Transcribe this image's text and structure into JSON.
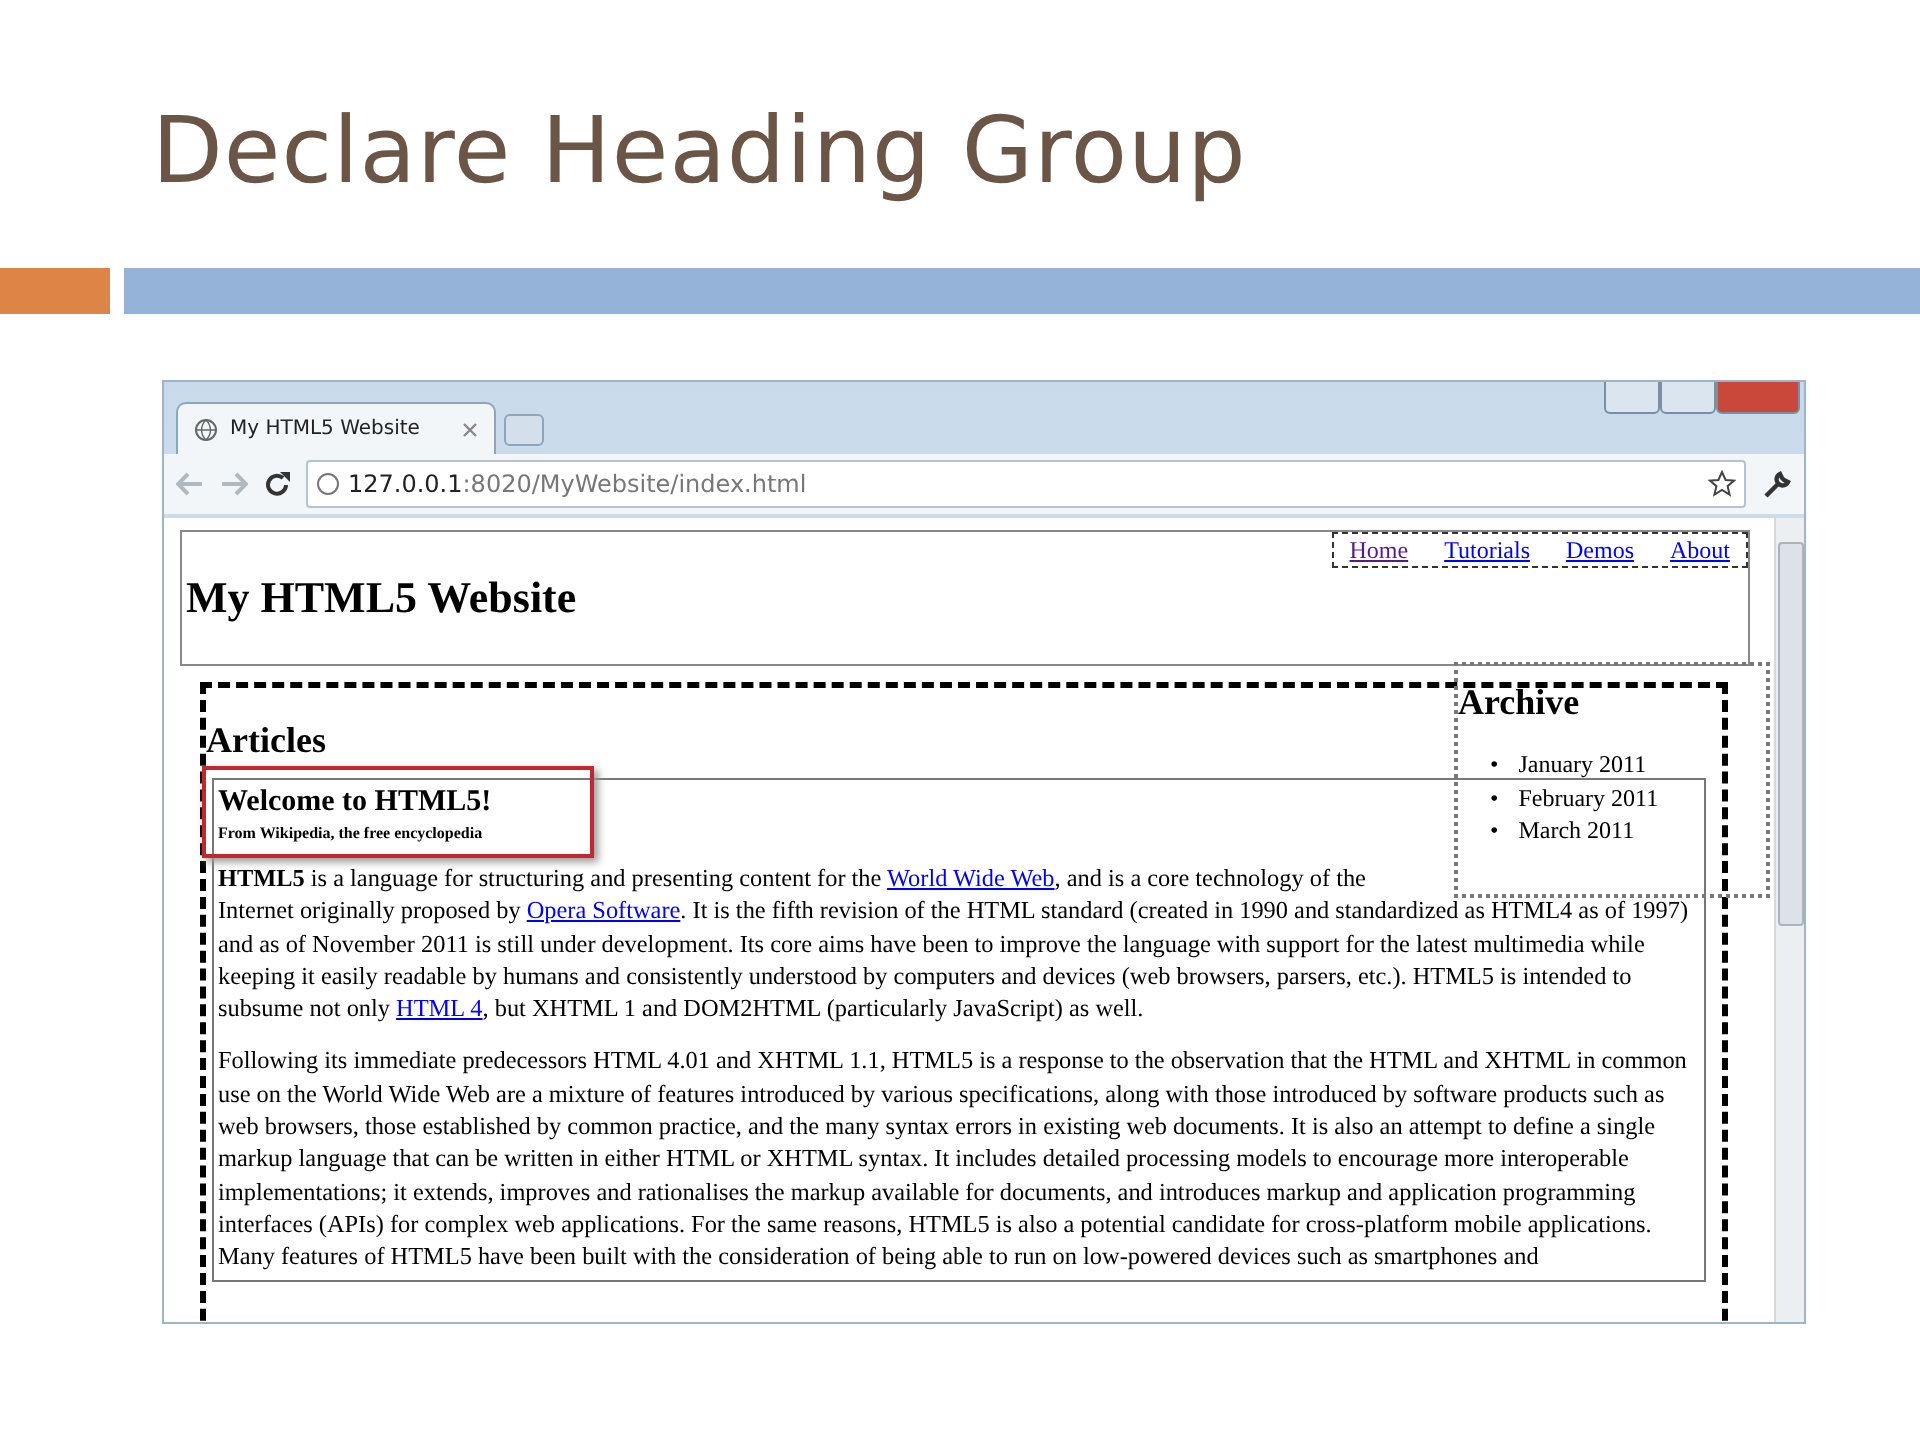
{
  "slide": {
    "title": "Declare Heading Group"
  },
  "browser": {
    "tab": {
      "title": "My HTML5 Website",
      "selected": true
    },
    "address": {
      "host": "127.0.0.1",
      "rest": ":8020/MyWebsite/index.html"
    }
  },
  "page": {
    "site_title": "My HTML5 Website",
    "nav": [
      {
        "label": "Home",
        "visited": true
      },
      {
        "label": "Tutorials",
        "visited": false
      },
      {
        "label": "Demos",
        "visited": false
      },
      {
        "label": "About",
        "visited": false
      }
    ],
    "section_title": "Articles",
    "hgroup": {
      "heading": "Welcome to HTML5!",
      "subheading": "From Wikipedia, the free encyclopedia"
    },
    "paragraphs": [
      {
        "parts": [
          {
            "kind": "bold",
            "text": "HTML5"
          },
          {
            "kind": "text",
            "text": " is a language for structuring and presenting content for the "
          },
          {
            "kind": "link",
            "text": "World Wide Web"
          },
          {
            "kind": "text",
            "text": ", and is a core technology of the Internet originally proposed by "
          },
          {
            "kind": "link",
            "text": "Opera Software"
          },
          {
            "kind": "text",
            "text": ". It is the fifth revision of the HTML standard (created in 1990 and standardized as HTML4 as of 1997) and as of November 2011 is still under development. Its core aims have been to improve the language with support for the latest multimedia while keeping it easily readable by humans and consistently understood by computers and devices (web browsers, parsers, etc.). HTML5 is intended to subsume not only "
          },
          {
            "kind": "link",
            "text": "HTML 4"
          },
          {
            "kind": "text",
            "text": ", but XHTML 1 and DOM2HTML (particularly JavaScript) as well."
          }
        ]
      },
      {
        "parts": [
          {
            "kind": "text",
            "text": "Following its immediate predecessors HTML 4.01 and XHTML 1.1, HTML5 is a response to the observation that the HTML and XHTML in common use on the World Wide Web are a mixture of features introduced by various specifications, along with those introduced by software products such as web browsers, those established by common practice, and the many syntax errors in existing web documents. It is also an attempt to define a single markup language that can be written in either HTML or XHTML syntax. It includes detailed processing models to encourage more interoperable implementations; it extends, improves and rationalises the markup available for documents, and introduces markup and application programming interfaces (APIs) for complex web applications. For the same reasons, HTML5 is also a potential candidate for cross-platform mobile applications. Many features of HTML5 have been built with the consideration of being able to run on low-powered devices such as smartphones and"
          }
        ]
      }
    ],
    "archive": {
      "title": "Archive",
      "bullet": "•",
      "items": [
        "January 2011",
        "February 2011",
        "March 2011"
      ]
    }
  }
}
